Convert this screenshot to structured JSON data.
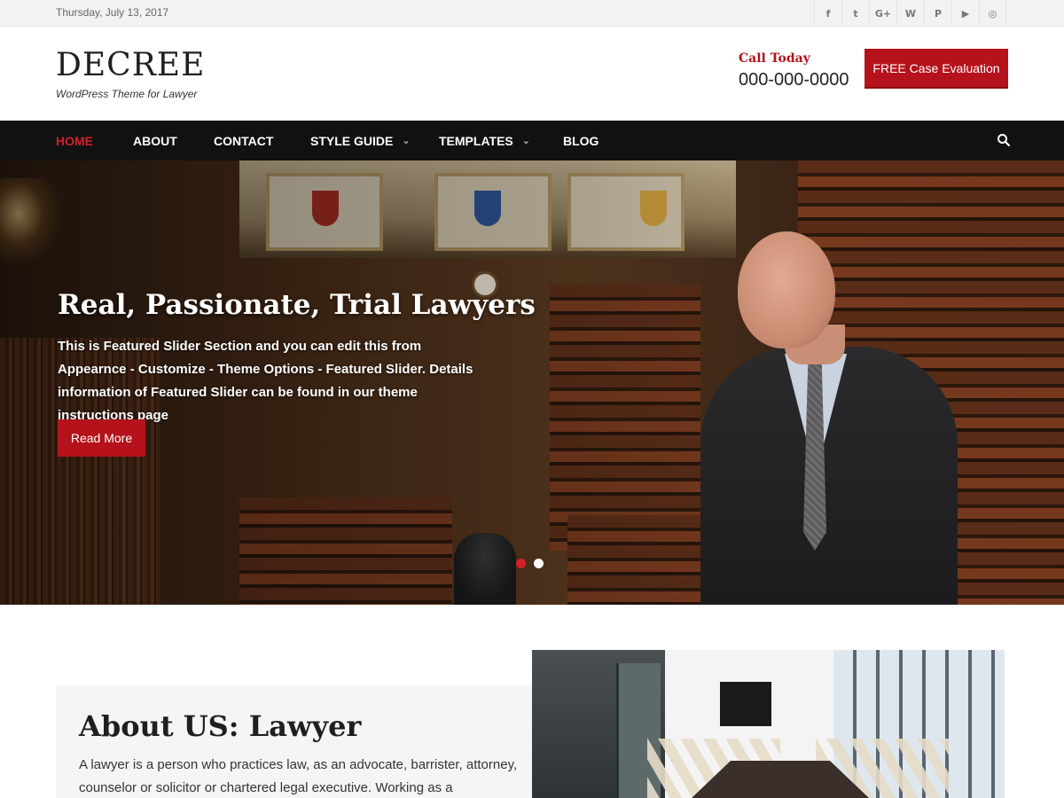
{
  "topbar": {
    "date": "Thursday, July 13, 2017",
    "social": [
      {
        "name": "facebook-icon",
        "glyph": "f"
      },
      {
        "name": "twitter-icon",
        "glyph": "t"
      },
      {
        "name": "google-plus-icon",
        "glyph": "G+"
      },
      {
        "name": "wordpress-icon",
        "glyph": "W"
      },
      {
        "name": "pinterest-icon",
        "glyph": "P"
      },
      {
        "name": "youtube-icon",
        "glyph": "▶"
      },
      {
        "name": "instagram-icon",
        "glyph": "◎"
      }
    ]
  },
  "header": {
    "logo": "DECREE",
    "tagline": "WordPress Theme for Lawyer",
    "call_label": "Call Today",
    "call_number": "000-000-0000",
    "cta": "FREE Case Evaluation"
  },
  "nav": {
    "items": [
      {
        "label": "HOME",
        "active": true,
        "dropdown": false
      },
      {
        "label": "ABOUT",
        "active": false,
        "dropdown": false
      },
      {
        "label": "CONTACT",
        "active": false,
        "dropdown": false
      },
      {
        "label": "STYLE GUIDE",
        "active": false,
        "dropdown": true
      },
      {
        "label": "TEMPLATES",
        "active": false,
        "dropdown": true
      },
      {
        "label": "BLOG",
        "active": false,
        "dropdown": false
      }
    ],
    "search_icon": "search-icon"
  },
  "hero": {
    "title": "Real, Passionate, Trial Lawyers",
    "text": "This is Featured Slider Section and you can edit this from Appearnce - Customize - Theme Options - Featured Slider. Details information of Featured Slider can be found in our theme instructions page",
    "button": "Read More",
    "slides": 2,
    "active_slide": 1
  },
  "about": {
    "title": "About US: Lawyer",
    "text": "A lawyer is a person who practices law, as an advocate, barrister, attorney, counselor or solicitor or chartered legal executive. Working as a"
  },
  "colors": {
    "accent": "#b5121b",
    "nav_bg": "#111111",
    "topbar_bg": "#f2f2f2"
  }
}
